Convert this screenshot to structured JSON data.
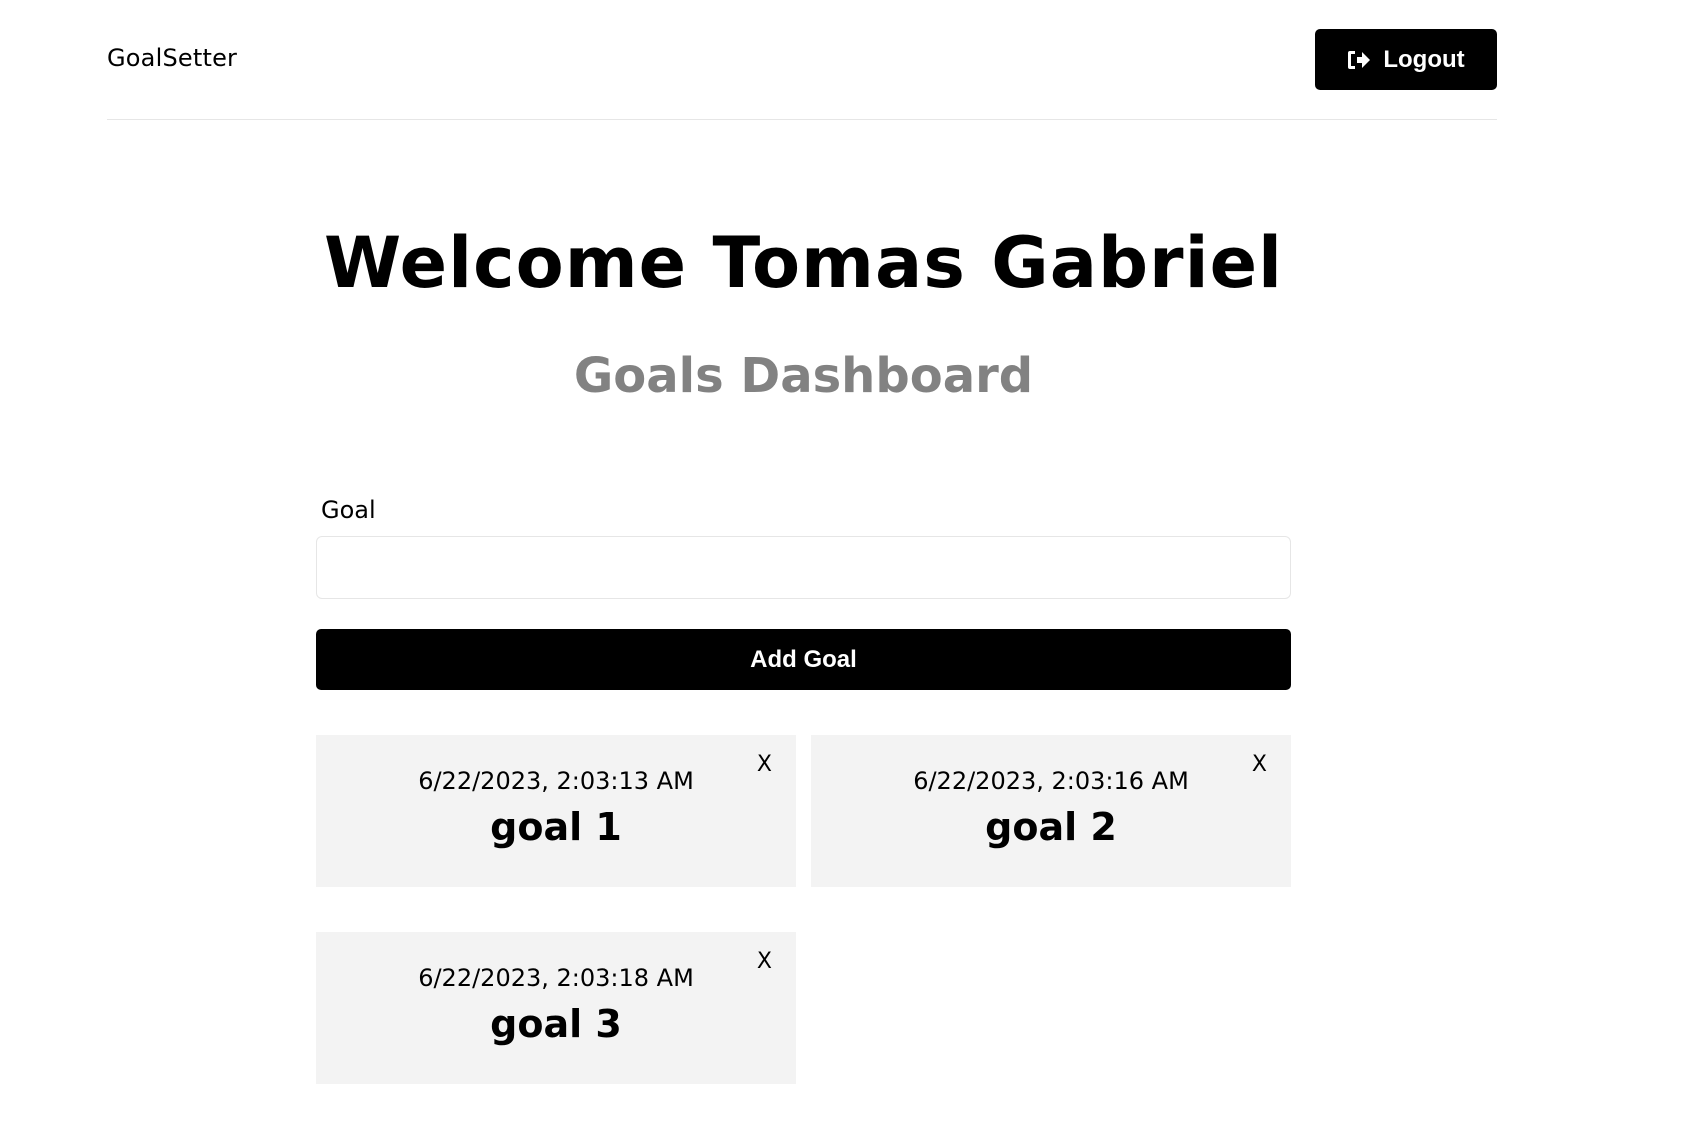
{
  "header": {
    "logo": "GoalSetter",
    "logout_label": "Logout",
    "logout_icon": "sign-out-icon"
  },
  "main": {
    "welcome": "Welcome Tomas Gabriel",
    "subtitle": "Goals Dashboard"
  },
  "form": {
    "goal_label": "Goal",
    "goal_value": "",
    "goal_placeholder": "",
    "submit_label": "Add Goal"
  },
  "goals": [
    {
      "date": "6/22/2023, 2:03:13 AM",
      "text": "goal 1",
      "close_label": "X"
    },
    {
      "date": "6/22/2023, 2:03:16 AM",
      "text": "goal 2",
      "close_label": "X"
    },
    {
      "date": "6/22/2023, 2:03:18 AM",
      "text": "goal 3",
      "close_label": "X"
    }
  ],
  "colors": {
    "primary": "#000000",
    "muted_heading": "#828282",
    "card_background": "#f3f3f3",
    "border": "#e6e6e6"
  }
}
